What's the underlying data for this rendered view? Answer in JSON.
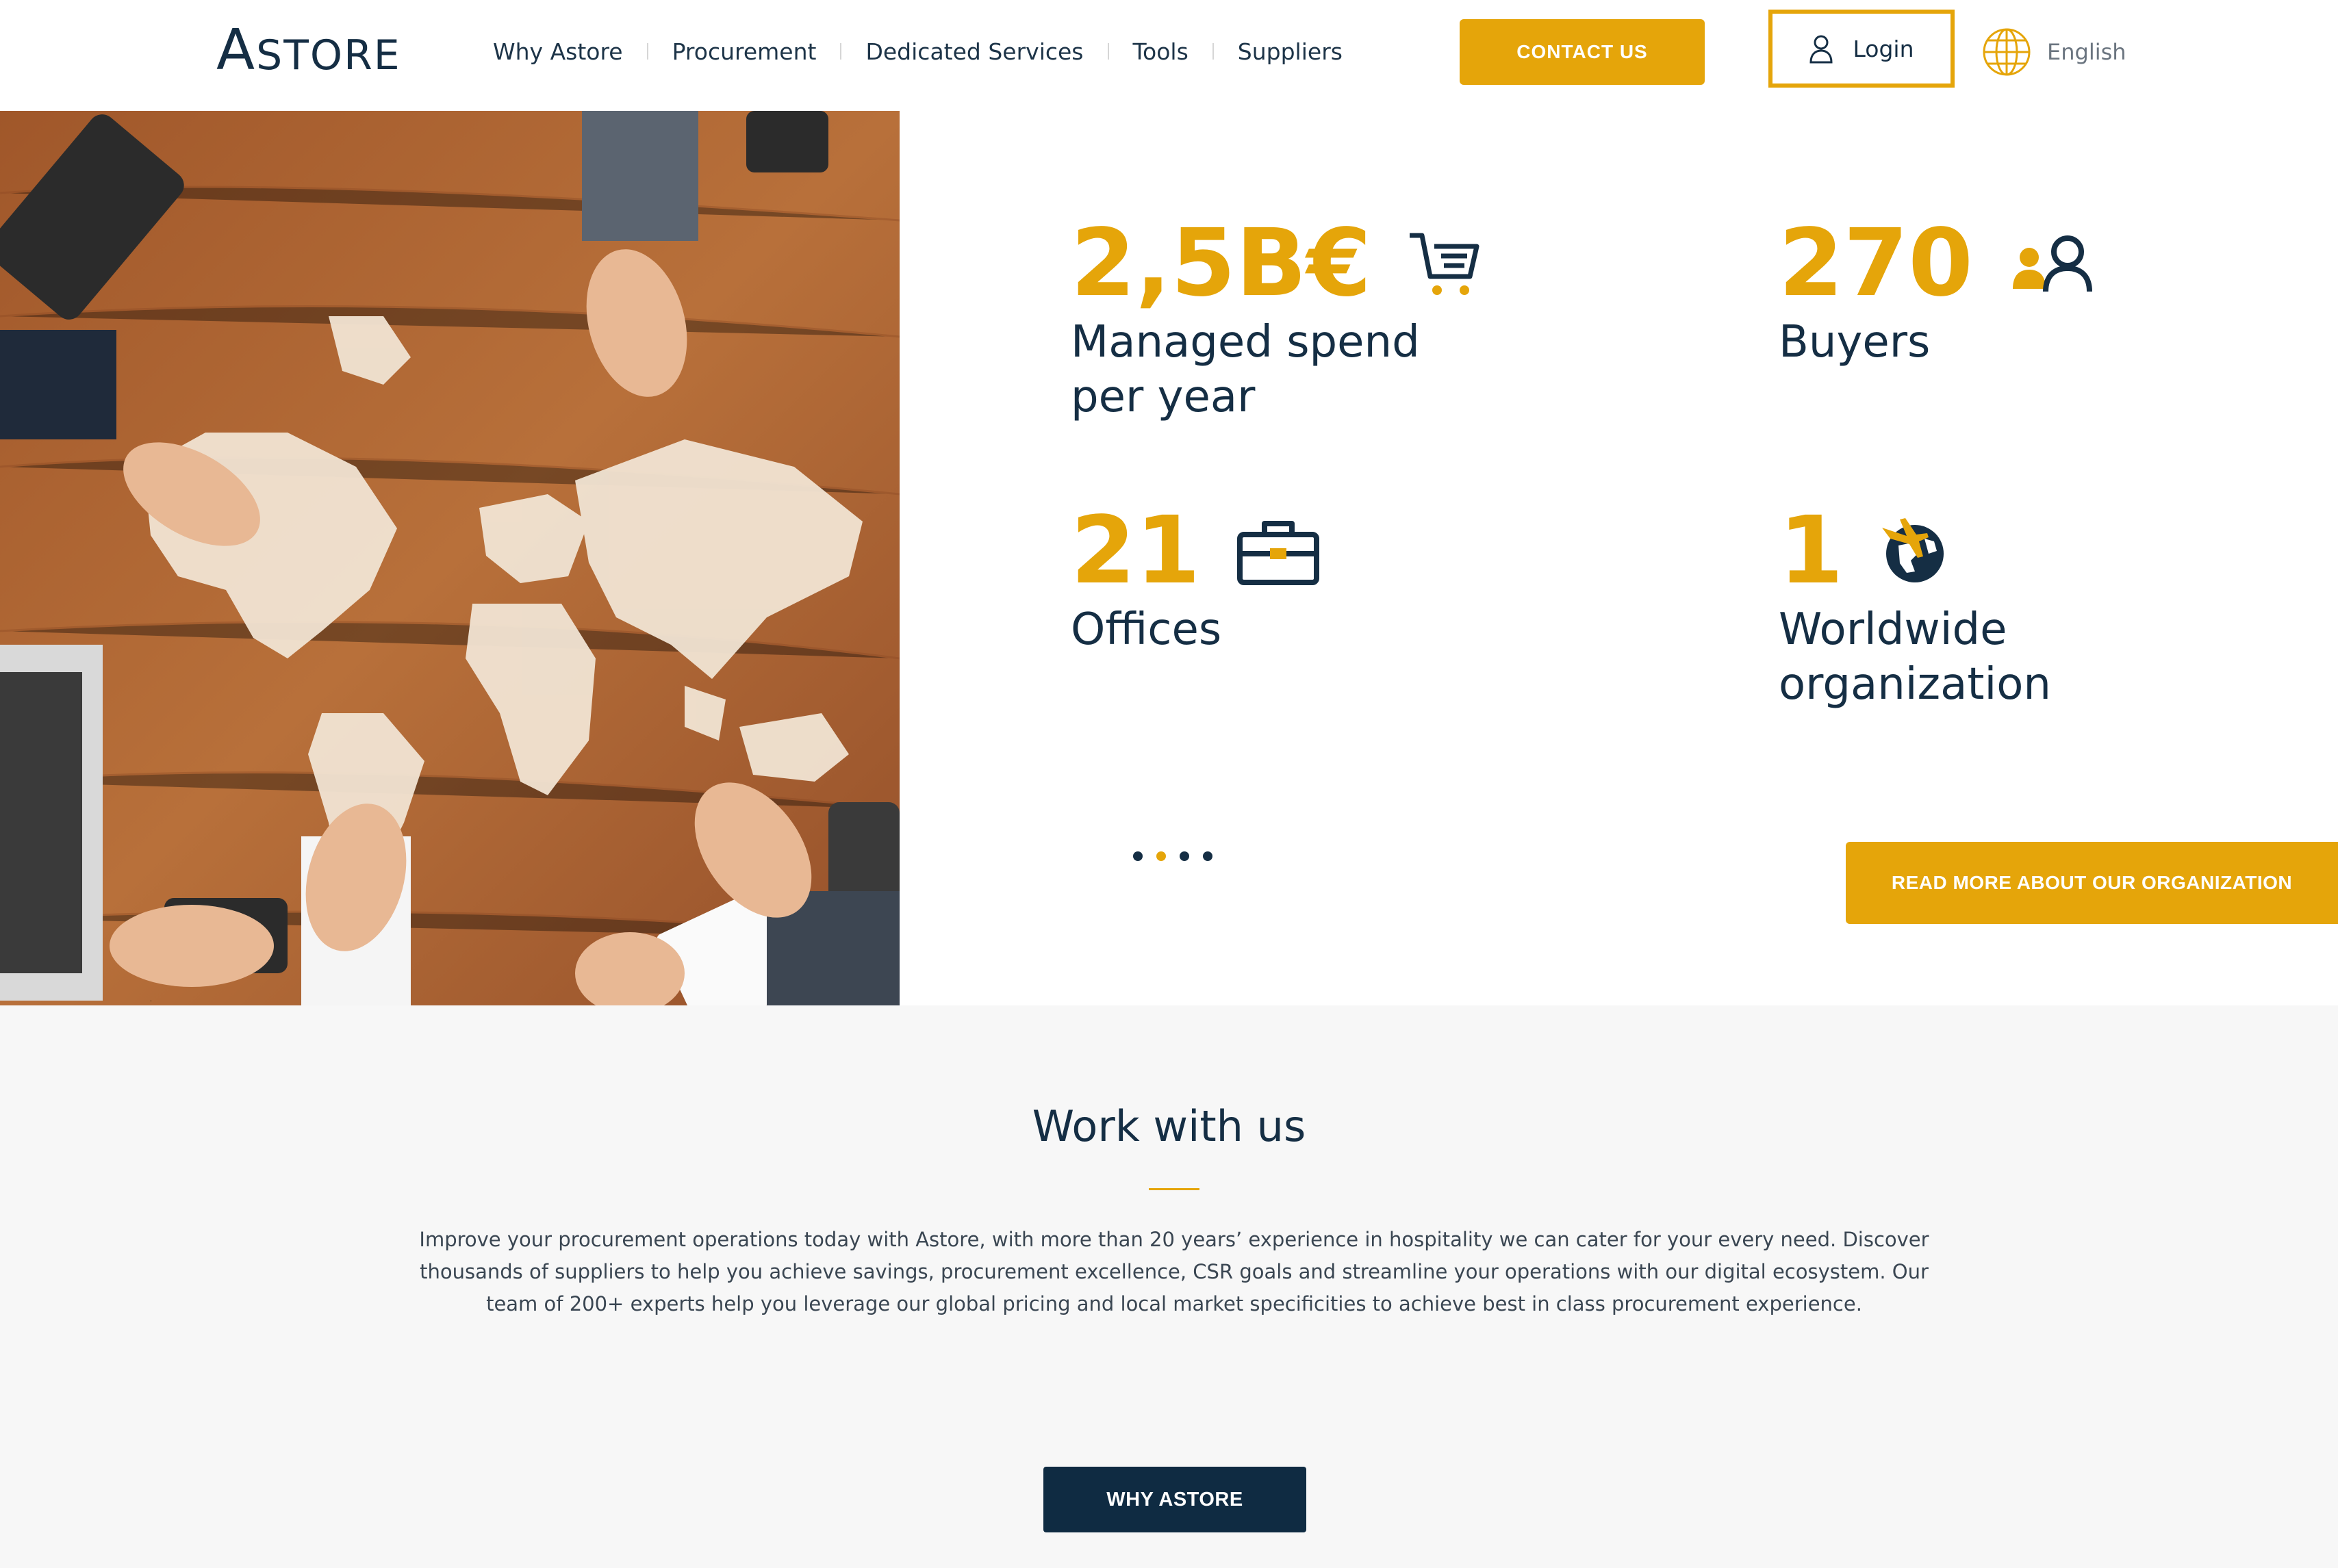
{
  "header": {
    "logo_first": "A",
    "logo_rest": "STORE",
    "nav": [
      "Why Astore",
      "Procurement",
      "Dedicated Services",
      "Tools",
      "Suppliers"
    ],
    "contact_label": "CONTACT US",
    "login_label": "Login",
    "language_label": "English"
  },
  "hero": {
    "image_icon": "world-map-desk-photo",
    "stats": [
      {
        "value": "2,5B€",
        "label": "Managed spend per year",
        "icon": "cart-icon"
      },
      {
        "value": "270",
        "label": "Buyers",
        "icon": "users-icon"
      },
      {
        "value": "21",
        "label": "Offices",
        "icon": "briefcase-icon"
      },
      {
        "value": "1",
        "label": "Worldwide organization",
        "icon": "globe-plane-icon"
      }
    ],
    "carousel": {
      "count": 4,
      "active_index": 1
    },
    "read_more_label": "READ MORE ABOUT OUR ORGANIZATION"
  },
  "work": {
    "title": "Work with us",
    "text": "Improve your procurement operations today with Astore, with more than 20 years’ experience in hospitality we can cater for your every need. Discover thousands of suppliers to help you achieve savings, procurement excellence, CSR goals and streamline your operations with our digital ecosystem. Our team of 200+ experts help you leverage our global pricing and local market specificities to achieve best in class procurement experience.",
    "button_label": "WHY ASTORE"
  },
  "colors": {
    "accent": "#e5a50a",
    "navy": "#152e44",
    "section_bg": "#f7f7f7"
  }
}
